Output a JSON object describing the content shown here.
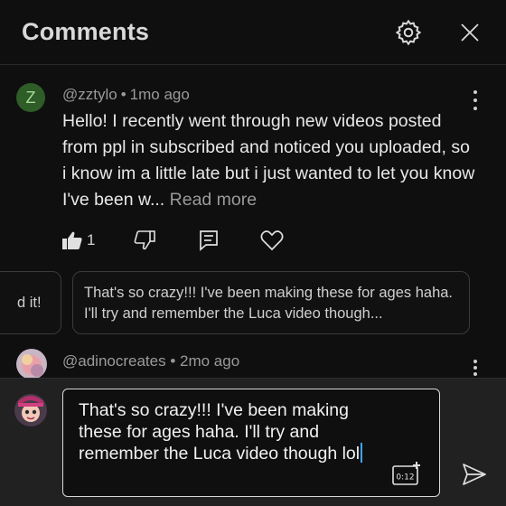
{
  "header": {
    "title": "Comments"
  },
  "comment": {
    "avatar_letter": "Z",
    "author": "@zztylo",
    "time": "1mo ago",
    "text": "Hello! I recently went through new videos posted from ppl in subscribed and noticed you uploaded, so i know im a little late but i just wanted to let you know I've been w...",
    "read_more": "Read more",
    "like_count": "1"
  },
  "suggestions": {
    "left_partial": "d it!",
    "main": "That's so crazy!!! I've been making these for ages haha. I'll try and remember the Luca video though..."
  },
  "next_comment": {
    "author": "@adinocreates",
    "time": "2mo ago"
  },
  "composer": {
    "text": "That's so crazy!!! I've been making these for ages haha. I'll try and remember the Luca video though lol",
    "timestamp_label": "0:12"
  },
  "colors": {
    "background": "#0f0f0f",
    "composer_bg": "#212121",
    "caret": "#3ea6ff"
  }
}
